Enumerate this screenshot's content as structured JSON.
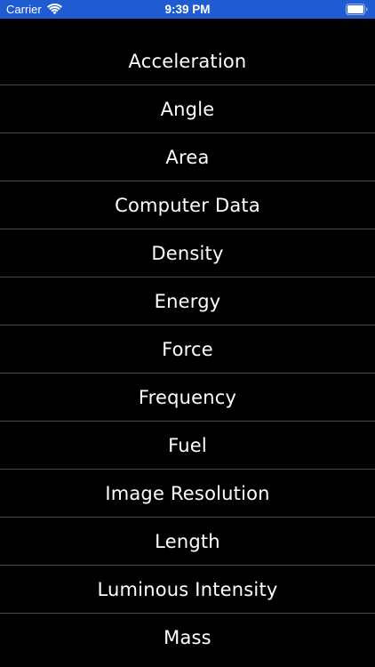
{
  "status_bar": {
    "carrier": "Carrier",
    "time": "9:39 PM",
    "background_color": "#1f5bd1",
    "icons": [
      "wifi-icon",
      "battery-icon"
    ]
  },
  "units_list": {
    "items": [
      {
        "label": "Acceleration"
      },
      {
        "label": "Angle"
      },
      {
        "label": "Area"
      },
      {
        "label": "Computer Data"
      },
      {
        "label": "Density"
      },
      {
        "label": "Energy"
      },
      {
        "label": "Force"
      },
      {
        "label": "Frequency"
      },
      {
        "label": "Fuel"
      },
      {
        "label": "Image Resolution"
      },
      {
        "label": "Length"
      },
      {
        "label": "Luminous Intensity"
      },
      {
        "label": "Mass"
      }
    ]
  }
}
